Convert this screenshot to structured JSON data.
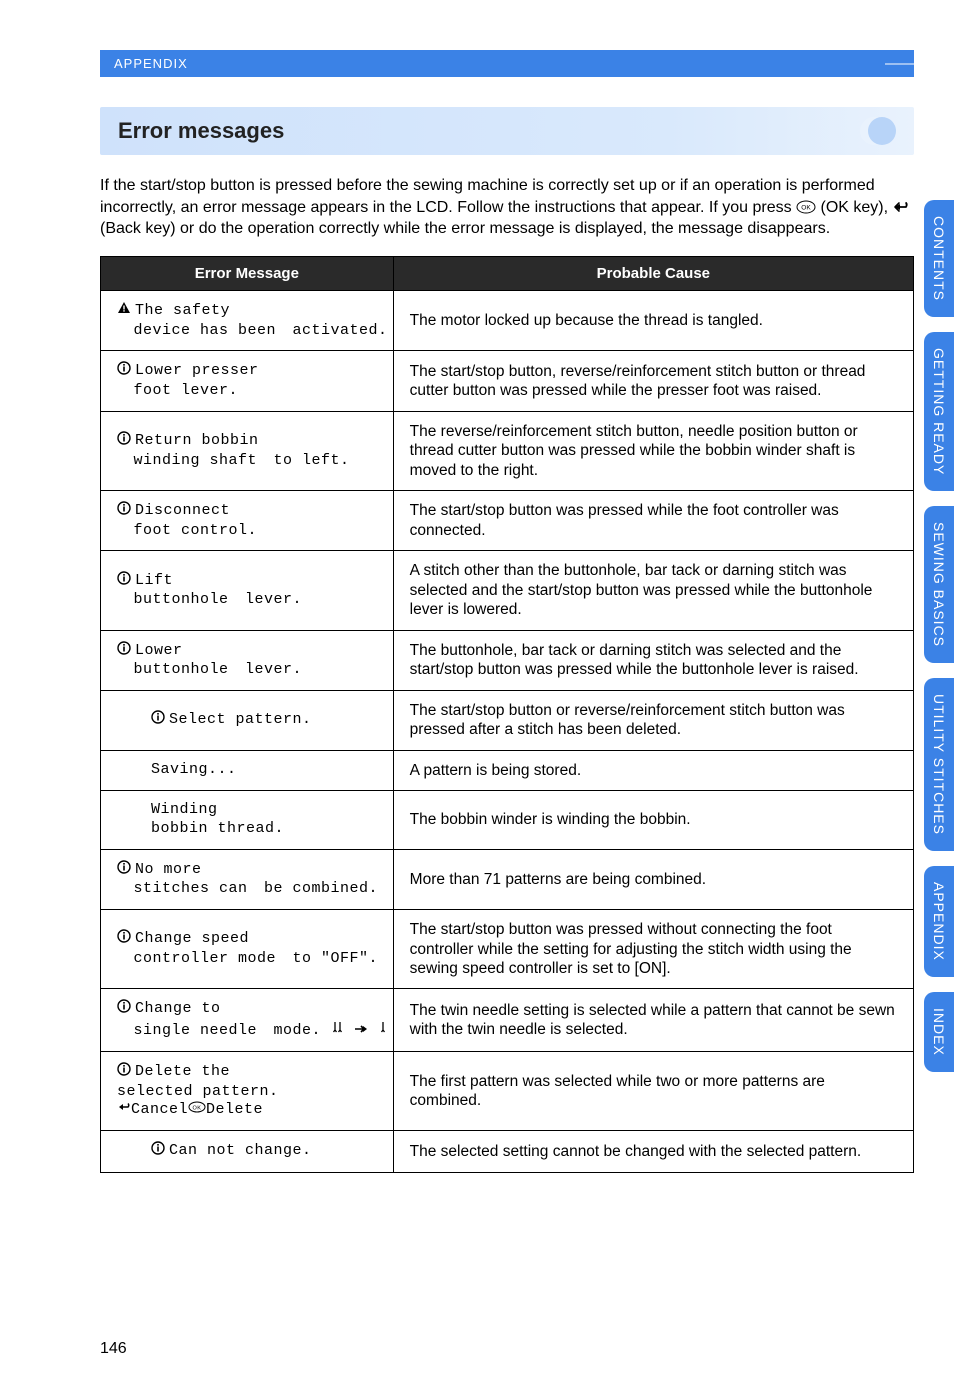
{
  "header": {
    "breadcrumb": "APPENDIX"
  },
  "section": {
    "title": "Error messages"
  },
  "intro": {
    "text_before_ok": "If the start/stop button is pressed before the sewing machine is correctly set up or if an operation is performed incorrectly, an error message appears in the LCD. Follow the instructions that appear. If you press ",
    "text_ok_label": "(OK key),",
    "text_after_ok": " (Back key) or do the operation correctly while the error message is displayed, the message disappears."
  },
  "table": {
    "headers": {
      "msg": "Error Message",
      "cause": "Probable Cause"
    },
    "rows": [
      {
        "icon": "warning-solid",
        "lines": [
          "The safety",
          "device has been",
          "activated."
        ],
        "cause": "The motor locked up because the thread is tangled."
      },
      {
        "icon": "info",
        "lines": [
          "Lower presser",
          "foot lever."
        ],
        "cause": "The start/stop button, reverse/reinforcement stitch button or thread cutter button was pressed while the presser foot was raised."
      },
      {
        "icon": "info",
        "lines": [
          "Return bobbin",
          "winding shaft",
          "to left."
        ],
        "cause": "The reverse/reinforcement stitch button, needle position button or thread cutter button was pressed while the bobbin winder shaft is moved to the right."
      },
      {
        "icon": "info",
        "lines": [
          "Disconnect",
          "foot control."
        ],
        "cause": "The start/stop button was pressed while the foot controller was connected."
      },
      {
        "icon": "info",
        "lines": [
          "Lift",
          "buttonhole",
          "lever."
        ],
        "cause": "A stitch other than the buttonhole, bar tack or darning stitch was selected and the start/stop button was pressed while the buttonhole lever is lowered."
      },
      {
        "icon": "info",
        "lines": [
          "Lower",
          "buttonhole",
          "lever."
        ],
        "cause": "The buttonhole, bar tack or darning stitch was selected and the start/stop button was pressed while the buttonhole lever is raised."
      },
      {
        "icon": "info",
        "lines": [
          "Select pattern."
        ],
        "nowrap": true,
        "cause": "The start/stop button or reverse/reinforcement stitch button was pressed after a stitch has been deleted."
      },
      {
        "icon": "none",
        "lines": [
          "Saving..."
        ],
        "cause": "A pattern is being stored."
      },
      {
        "icon": "none",
        "lines": [
          "Winding",
          "bobbin thread."
        ],
        "cause": "The bobbin winder is winding the bobbin."
      },
      {
        "icon": "info",
        "lines": [
          "No more",
          "stitches can",
          "be combined."
        ],
        "cause": "More than 71 patterns are being combined."
      },
      {
        "icon": "info",
        "lines": [
          "Change speed",
          "controller mode",
          "to \"OFF\"."
        ],
        "cause": "The start/stop button was pressed without connecting the foot controller while the setting for adjusting the stitch width using the sewing speed controller is set to [ON]."
      },
      {
        "icon": "info",
        "lines": [
          "Change to",
          "single needle"
        ],
        "extra": "mode_twin",
        "cause": "The twin needle setting is selected while a pattern that cannot be sewn with the twin needle is selected."
      },
      {
        "icon": "info",
        "lines": [
          "Delete the"
        ],
        "extra": "delete_pattern",
        "cause": "The first pattern was selected while two or more patterns are combined."
      },
      {
        "icon": "info",
        "lines": [
          "Can not change."
        ],
        "nowrap": true,
        "cause": "The selected setting cannot be changed with the selected pattern."
      }
    ],
    "extras": {
      "mode_twin_line3_prefix": "mode. ",
      "delete_line2": "selected pattern.",
      "delete_cancel": "Cancel",
      "delete_delete": "Delete"
    }
  },
  "tabs": [
    {
      "label": "CONTENTS"
    },
    {
      "label": "GETTING READY"
    },
    {
      "label": "SEWING BASICS"
    },
    {
      "label": "UTILITY STITCHES"
    },
    {
      "label": "APPENDIX"
    },
    {
      "label": "INDEX"
    }
  ],
  "page_number": "146"
}
